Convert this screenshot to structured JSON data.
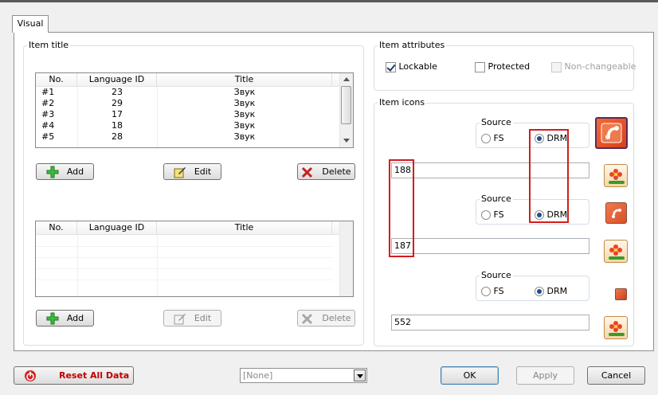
{
  "tabs": {
    "visual": "Visual"
  },
  "item_title": {
    "label": "Item title",
    "columns": [
      "No.",
      "Language ID",
      "Title"
    ],
    "rows": [
      {
        "no": "#1",
        "lang": "23",
        "title": "Звук"
      },
      {
        "no": "#2",
        "lang": "29",
        "title": "Звук"
      },
      {
        "no": "#3",
        "lang": "17",
        "title": "Звук"
      },
      {
        "no": "#4",
        "lang": "18",
        "title": "Звук"
      },
      {
        "no": "#5",
        "lang": "28",
        "title": "Звук"
      }
    ],
    "add": "Add",
    "edit": "Edit",
    "delete": "Delete"
  },
  "lower_table": {
    "columns": [
      "No.",
      "Language ID",
      "Title"
    ],
    "add": "Add",
    "edit": "Edit",
    "delete": "Delete"
  },
  "item_attributes": {
    "label": "Item attributes",
    "lockable": "Lockable",
    "protected": "Protected",
    "non_changeable": "Non-changeable",
    "lockable_checked": true,
    "protected_checked": false,
    "non_changeable_checked": false
  },
  "item_icons": {
    "label": "Item icons",
    "icons": [
      {
        "source_label": "Source",
        "fs": "FS",
        "drm": "DRM",
        "selected": "DRM",
        "value": "188"
      },
      {
        "source_label": "Source",
        "fs": "FS",
        "drm": "DRM",
        "selected": "DRM",
        "value": "187"
      },
      {
        "source_label": "Source",
        "fs": "FS",
        "drm": "DRM",
        "selected": "DRM",
        "value": "552"
      }
    ]
  },
  "footer": {
    "reset": "Reset All Data",
    "select_value": "[None]",
    "ok": "OK",
    "apply": "Apply",
    "cancel": "Cancel"
  },
  "colors": {
    "accent_red": "#d41c1c",
    "reset_text": "#c00000"
  }
}
